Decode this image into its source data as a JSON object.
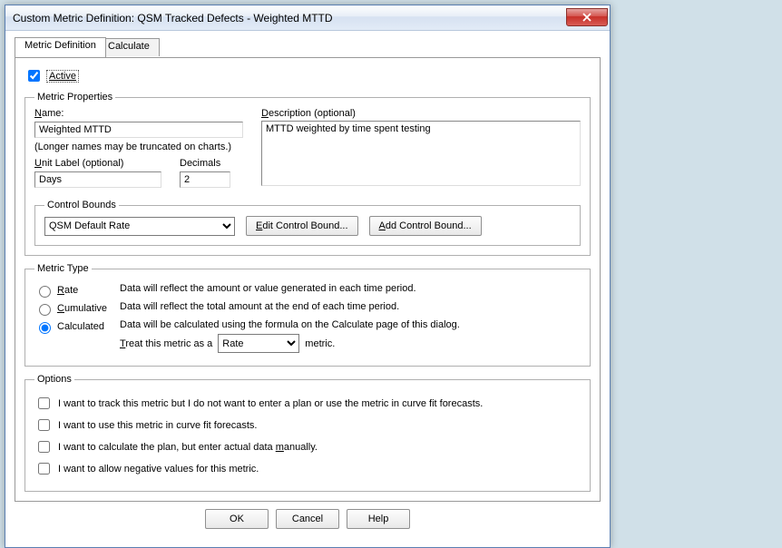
{
  "title": "Custom Metric Definition: QSM Tracked Defects - Weighted MTTD",
  "tabs": {
    "t0": "Metric Definition",
    "t1": "Calculate"
  },
  "active": {
    "label": "Active",
    "checked": true
  },
  "props": {
    "legend": "Metric Properties",
    "name_u": "N",
    "name_rest": "ame:",
    "name_val": "Weighted MTTD",
    "hint": "(Longer names may be truncated on charts.)",
    "unit_u": "U",
    "unit_rest": "nit Label (optional)",
    "unit_val": "Days",
    "dec_lbl": "Decimals",
    "dec_val": "2",
    "desc_u": "D",
    "desc_rest": "escription (optional)",
    "desc_val": "MTTD weighted by time spent testing"
  },
  "bounds": {
    "legend": "Control Bounds",
    "select_val": "QSM Default Rate",
    "edit_u": "E",
    "edit_rest": "dit Control Bound...",
    "add_u": "A",
    "add_rest": "dd Control Bound..."
  },
  "mtype": {
    "legend": "Metric Type",
    "r_rate_u": "R",
    "r_rate_rest": "ate",
    "r_rate_desc": "Data will reflect the amount or value generated in each time period.",
    "r_cum_u": "C",
    "r_cum_rest": "umulative",
    "r_cum_desc": "Data will reflect the total amount at the end of each time period.",
    "r_calc_lbl": "Calculated",
    "r_calc_desc": "Data will be calculated using the formula on the Calculate page of this dialog.",
    "treat_u": "T",
    "treat_rest": "reat this metric as a",
    "treat_sel": "Rate",
    "treat_suffix": "metric."
  },
  "options": {
    "legend": "Options",
    "o1": "I want to track this metric but I do not want to enter a plan or use the metric in curve fit forecasts.",
    "o2": "I want to use this metric in curve fit forecasts.",
    "o3a": "I want to calculate the plan, but enter actual data ",
    "o3_u": "m",
    "o3b": "anually.",
    "o4a": "I want to allow ne",
    "o4_u": "g",
    "o4b": "ative values for this metric."
  },
  "footer": {
    "ok": "OK",
    "cancel": "Cancel",
    "help": "Help"
  }
}
